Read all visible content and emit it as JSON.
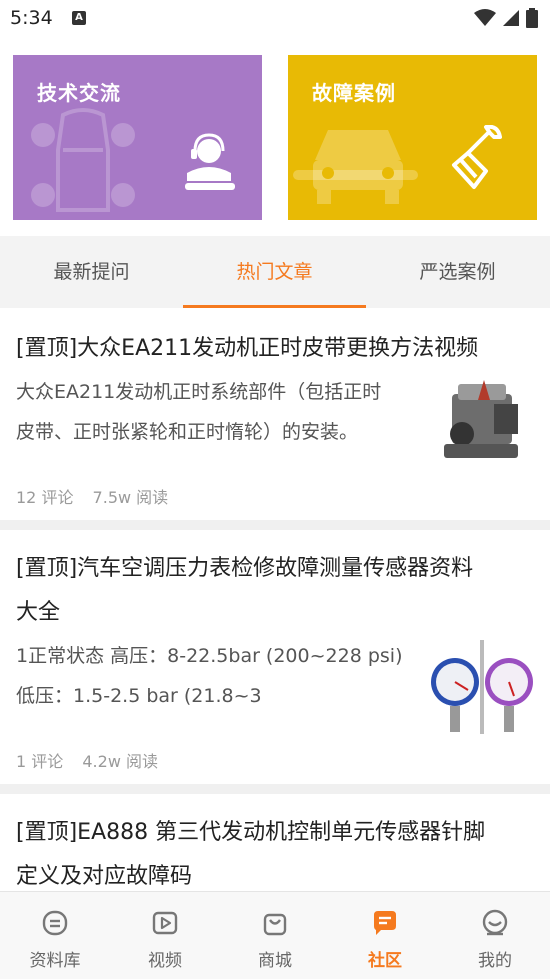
{
  "status_bar": {
    "time": "5:34",
    "notif_letter": "A"
  },
  "cards": {
    "tech": {
      "title": "技术交流",
      "color": "#a779c6"
    },
    "fault": {
      "title": "故障案例",
      "color": "#e8ba05"
    }
  },
  "tabs": [
    {
      "label": "最新提问"
    },
    {
      "label": "热门文章",
      "active": true
    },
    {
      "label": "严选案例"
    }
  ],
  "articles": [
    {
      "title": "[置顶]大众EA211发动机正时皮带更换方法视频",
      "summary_line1": "大众EA211发动机正时系统部件（包括正时",
      "summary_line2": "皮带、正时张紧轮和正时惰轮）的安装。",
      "comments": "12 评论",
      "reads": "7.5w 阅读"
    },
    {
      "title_line1": "[置顶]汽车空调压力表检修故障测量传感器资料",
      "title_line2": "大全",
      "summary_line1": "1正常状态 高压：8-22.5bar (200~228 psi)",
      "summary_line2": "低压：1.5-2.5 bar (21.8~3",
      "comments": "1 评论",
      "reads": "4.2w 阅读"
    },
    {
      "title_line1": "[置顶]EA888 第三代发动机控制单元传感器针脚",
      "title_line2": "定义及对应故障码"
    }
  ],
  "bottom_nav": [
    {
      "label": "资料库",
      "icon": "database-icon"
    },
    {
      "label": "视频",
      "icon": "video-icon"
    },
    {
      "label": "商城",
      "icon": "shop-bag-icon"
    },
    {
      "label": "社区",
      "icon": "community-chat-icon",
      "active": true
    },
    {
      "label": "我的",
      "icon": "profile-icon"
    }
  ],
  "accent_color": "#f57a1f"
}
